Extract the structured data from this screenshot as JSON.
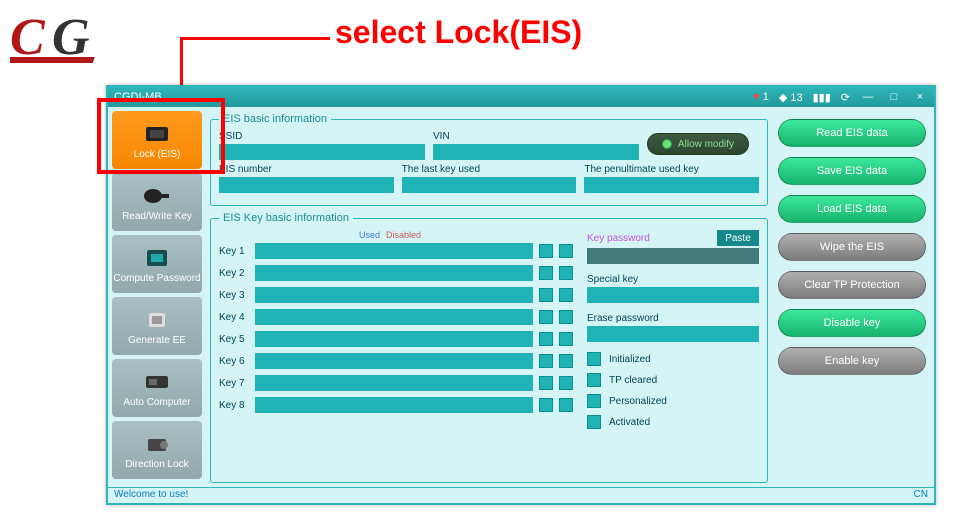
{
  "annotation": "select Lock(EIS)",
  "window": {
    "title": "CGDI-MB",
    "heart_count": "1",
    "diamond_count": "13",
    "status_left": "Welcome to use!",
    "status_right": "CN"
  },
  "sidebar": [
    {
      "label": "Lock (EIS)",
      "icon": "eis-icon"
    },
    {
      "label": "Read/Write Key",
      "icon": "key-icon"
    },
    {
      "label": "Compute Password",
      "icon": "cpu-icon"
    },
    {
      "label": "Generate EE",
      "icon": "chip-icon"
    },
    {
      "label": "Auto Computer",
      "icon": "ecu-icon"
    },
    {
      "label": "Direction Lock",
      "icon": "lock-icon"
    }
  ],
  "panel1": {
    "legend": "EIS basic information",
    "ssid_label": "SSID",
    "vin_label": "VIN",
    "eis_num_label": "EIS number",
    "last_key_label": "The last key used",
    "penult_key_label": "The penultimate used key",
    "allow_modify": "Allow modify"
  },
  "panel2": {
    "legend": "EIS Key basic information",
    "header_used": "Used",
    "header_disabled": "Disabled",
    "keys": [
      "Key 1",
      "Key 2",
      "Key 3",
      "Key 4",
      "Key 5",
      "Key 6",
      "Key 7",
      "Key 8"
    ],
    "key_password": "Key password",
    "paste": "Paste",
    "special_key": "Special key",
    "erase_password": "Erase password",
    "statuses": [
      "Initialized",
      "TP cleared",
      "Personalized",
      "Activated"
    ]
  },
  "buttons": {
    "read": "Read EIS data",
    "save": "Save EIS data",
    "load": "Load EIS data",
    "wipe": "Wipe the EIS",
    "clear_tp": "Clear TP Protection",
    "disable": "Disable key",
    "enable": "Enable key"
  }
}
